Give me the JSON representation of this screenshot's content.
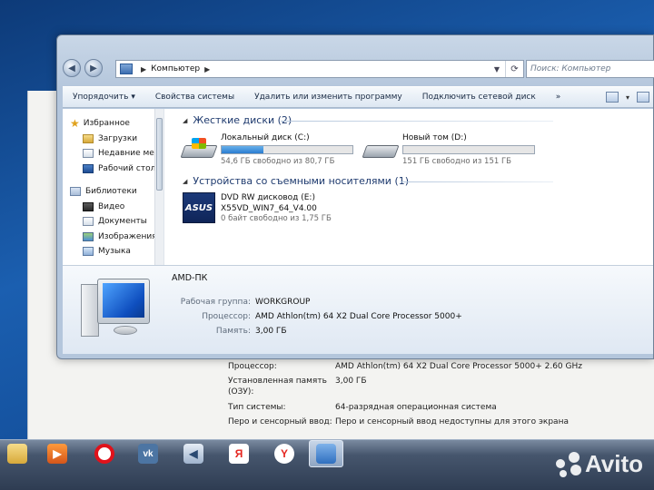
{
  "address_bar": {
    "path": "Компьютер",
    "search_placeholder": "Поиск: Компьютер"
  },
  "toolbar": {
    "organize": "Упорядочить",
    "system_properties": "Свойства системы",
    "uninstall": "Удалить или изменить программу",
    "map_drive": "Подключить сетевой диск",
    "more": "»"
  },
  "nav_pane": {
    "favorites": "Избранное",
    "downloads": "Загрузки",
    "recent": "Недавние места",
    "desktop": "Рабочий стол",
    "libraries": "Библиотеки",
    "video": "Видео",
    "documents": "Документы",
    "pictures": "Изображения",
    "music": "Музыка"
  },
  "groups": {
    "hdd_header": "Жесткие диски (2)",
    "removable_header": "Устройства со съемными носителями (1)"
  },
  "drives": [
    {
      "name": "Локальный диск (C:)",
      "free_text": "54,6 ГБ свободно из 80,7 ГБ",
      "used_fraction": 0.32
    },
    {
      "name": "Новый том (D:)",
      "free_text": "151 ГБ свободно из 151 ГБ",
      "used_fraction": 0.0
    }
  ],
  "dvd": {
    "name": "DVD RW дисковод (E:)",
    "label": "X55VD_WIN7_64_V4.00",
    "free_text": "0 байт свободно из 1,75 ГБ",
    "logo": "ASUS"
  },
  "details": {
    "computer_name": "AMD-ПК",
    "workgroup_label": "Рабочая группа:",
    "workgroup_value": "WORKGROUP",
    "cpu_label": "Процессор:",
    "cpu_value": "AMD Athlon(tm) 64 X2 Dual Core Processor 5000+",
    "ram_label": "Память:",
    "ram_value": "3,00 ГБ"
  },
  "background_window": {
    "cpu_label": "Процессор:",
    "cpu_value": "AMD Athlon(tm) 64 X2 Dual Core Processor 5000+   2.60 GHz",
    "ram_label": "Установленная память (ОЗУ):",
    "ram_value": "3,00 ГБ",
    "systype_label": "Тип системы:",
    "systype_value": "64-разрядная операционная система",
    "pen_label": "Перо и сенсорный ввод:",
    "pen_value": "Перо и сенсорный ввод недоступны для этого экрана"
  },
  "taskbar": {
    "yandex_glyph": "Я",
    "yandex_browser_glyph": "Y",
    "vk_glyph": "vk"
  },
  "watermark": "Avito",
  "colors": {
    "accent_bar": "#2a7cd0",
    "opera": "#e0121b",
    "vk": "#4c75a3",
    "yandex": "#e52620"
  }
}
